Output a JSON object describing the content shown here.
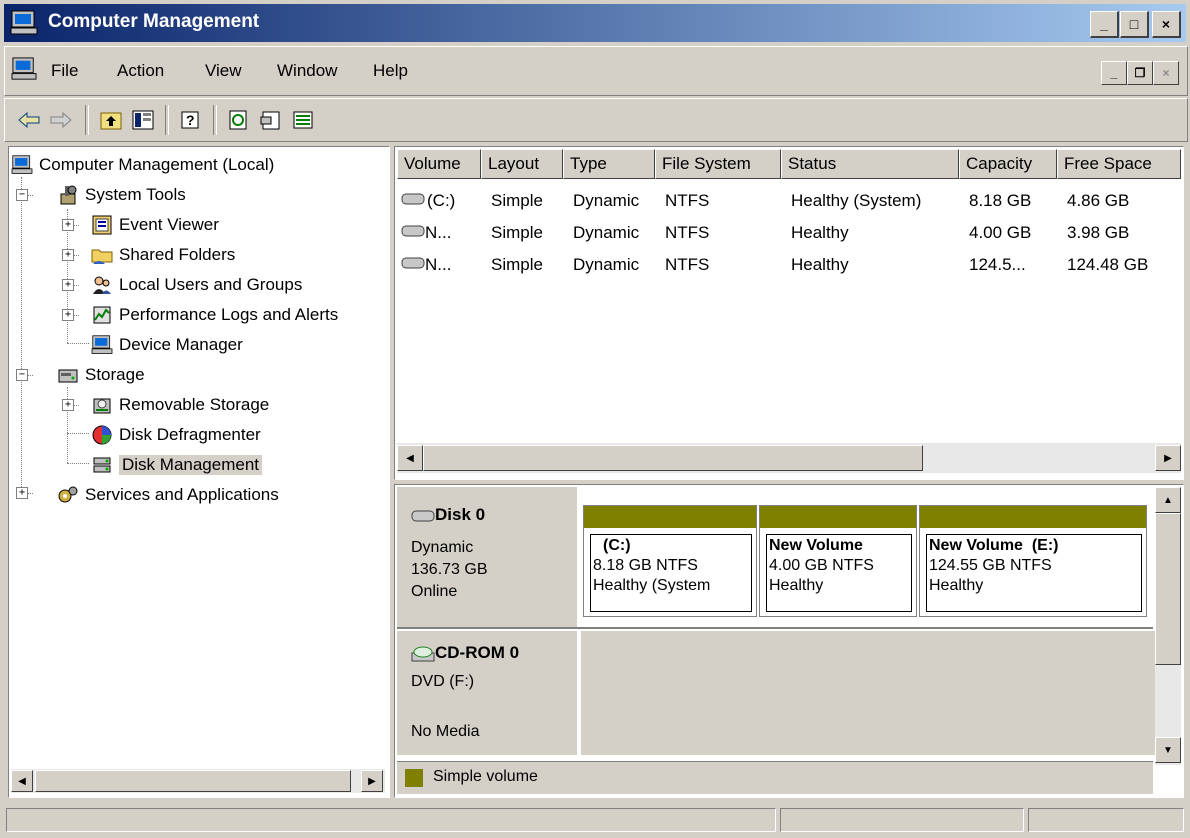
{
  "window": {
    "title": "Computer Management",
    "title_icon": "computer-icon"
  },
  "title_buttons": {
    "minimize": "_",
    "maximize": "□",
    "close": "×"
  },
  "menu": [
    "File",
    "Action",
    "View",
    "Window",
    "Help"
  ],
  "toolbar": [
    "back-arrow-icon",
    "forward-arrow-icon",
    "up-folder-icon",
    "show-hide-tree-icon",
    "help-icon",
    "refresh-icon",
    "properties-icon",
    "export-list-icon"
  ],
  "tree": {
    "root": "Computer Management (Local)",
    "system_tools": "System Tools",
    "event_viewer": "Event Viewer",
    "shared_folders": "Shared Folders",
    "local_users": "Local Users and Groups",
    "perf_logs": "Performance Logs and Alerts",
    "device_manager": "Device Manager",
    "storage": "Storage",
    "removable_storage": "Removable Storage",
    "disk_defrag": "Disk Defragmenter",
    "disk_management": "Disk Management",
    "services_apps": "Services and Applications"
  },
  "volumes": {
    "columns": [
      "Volume",
      "Layout",
      "Type",
      "File System",
      "Status",
      "Capacity",
      "Free Space"
    ],
    "rows": [
      [
        "(C:)",
        "Simple",
        "Dynamic",
        "NTFS",
        "Healthy (System)",
        "8.18 GB",
        "4.86 GB"
      ],
      [
        "N...",
        "Simple",
        "Dynamic",
        "NTFS",
        "Healthy",
        "4.00 GB",
        "3.98 GB"
      ],
      [
        "N...",
        "Simple",
        "Dynamic",
        "NTFS",
        "Healthy",
        "124.5...",
        "124.48 GB"
      ]
    ]
  },
  "disks": {
    "disk0": {
      "name": "Disk 0",
      "type": "Dynamic",
      "size": "136.73 GB",
      "state": "Online",
      "partitions": [
        {
          "title": "(C:)",
          "size": "8.18 GB NTFS",
          "status": "Healthy (System"
        },
        {
          "title": "New Volume",
          "size": "4.00 GB NTFS",
          "status": "Healthy"
        },
        {
          "title": "New Volume  (E:)",
          "size": "124.55 GB NTFS",
          "status": "Healthy"
        }
      ]
    },
    "cdrom0": {
      "name": "CD-ROM 0",
      "drive": "DVD (F:)",
      "media": "No Media"
    }
  },
  "legend": {
    "label": "Simple volume",
    "color": "#7f7f00"
  }
}
